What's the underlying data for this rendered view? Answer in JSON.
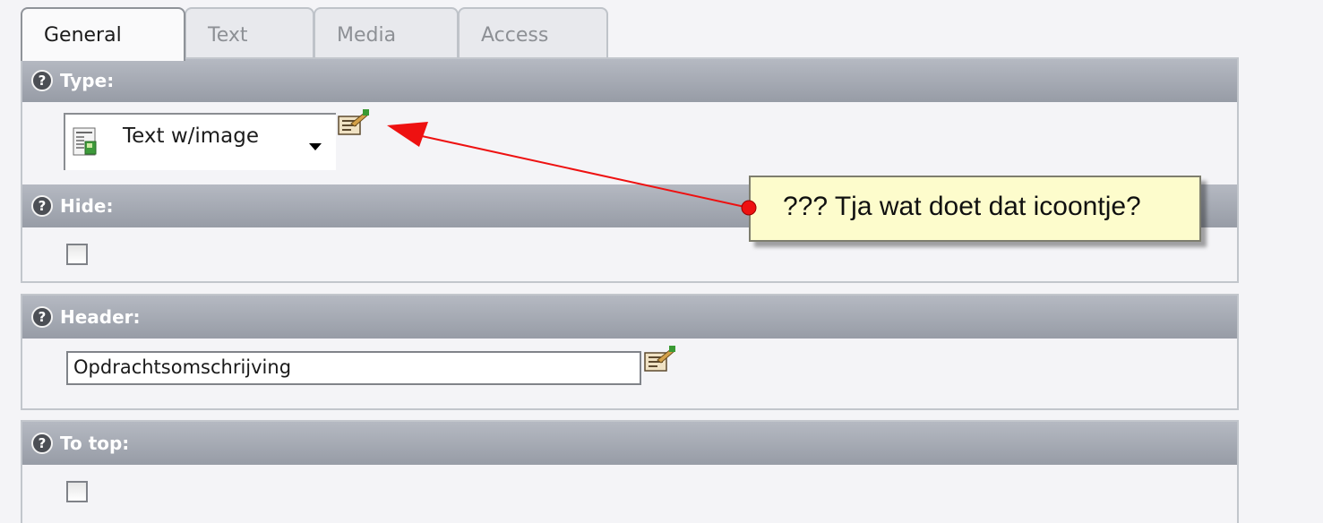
{
  "tabs": [
    {
      "label": "General",
      "active": true
    },
    {
      "label": "Text",
      "active": false
    },
    {
      "label": "Media",
      "active": false
    },
    {
      "label": "Access",
      "active": false
    }
  ],
  "fields": {
    "type": {
      "label": "Type:",
      "selected": "Text w/image",
      "help_icon": "question-icon",
      "wizard_icon": "edit-wizard-icon"
    },
    "hide": {
      "label": "Hide:",
      "checked": false
    },
    "header": {
      "label": "Header:",
      "value": "Opdrachtsomschrijving",
      "wizard_icon": "edit-wizard-icon"
    },
    "to_top": {
      "label": "To top:",
      "checked": false
    }
  },
  "help_glyph": "?",
  "annotation": {
    "text": "??? Tja wat doet dat icoontje?",
    "arrow_color": "#ee1111",
    "note_color": "#fdfccc"
  }
}
